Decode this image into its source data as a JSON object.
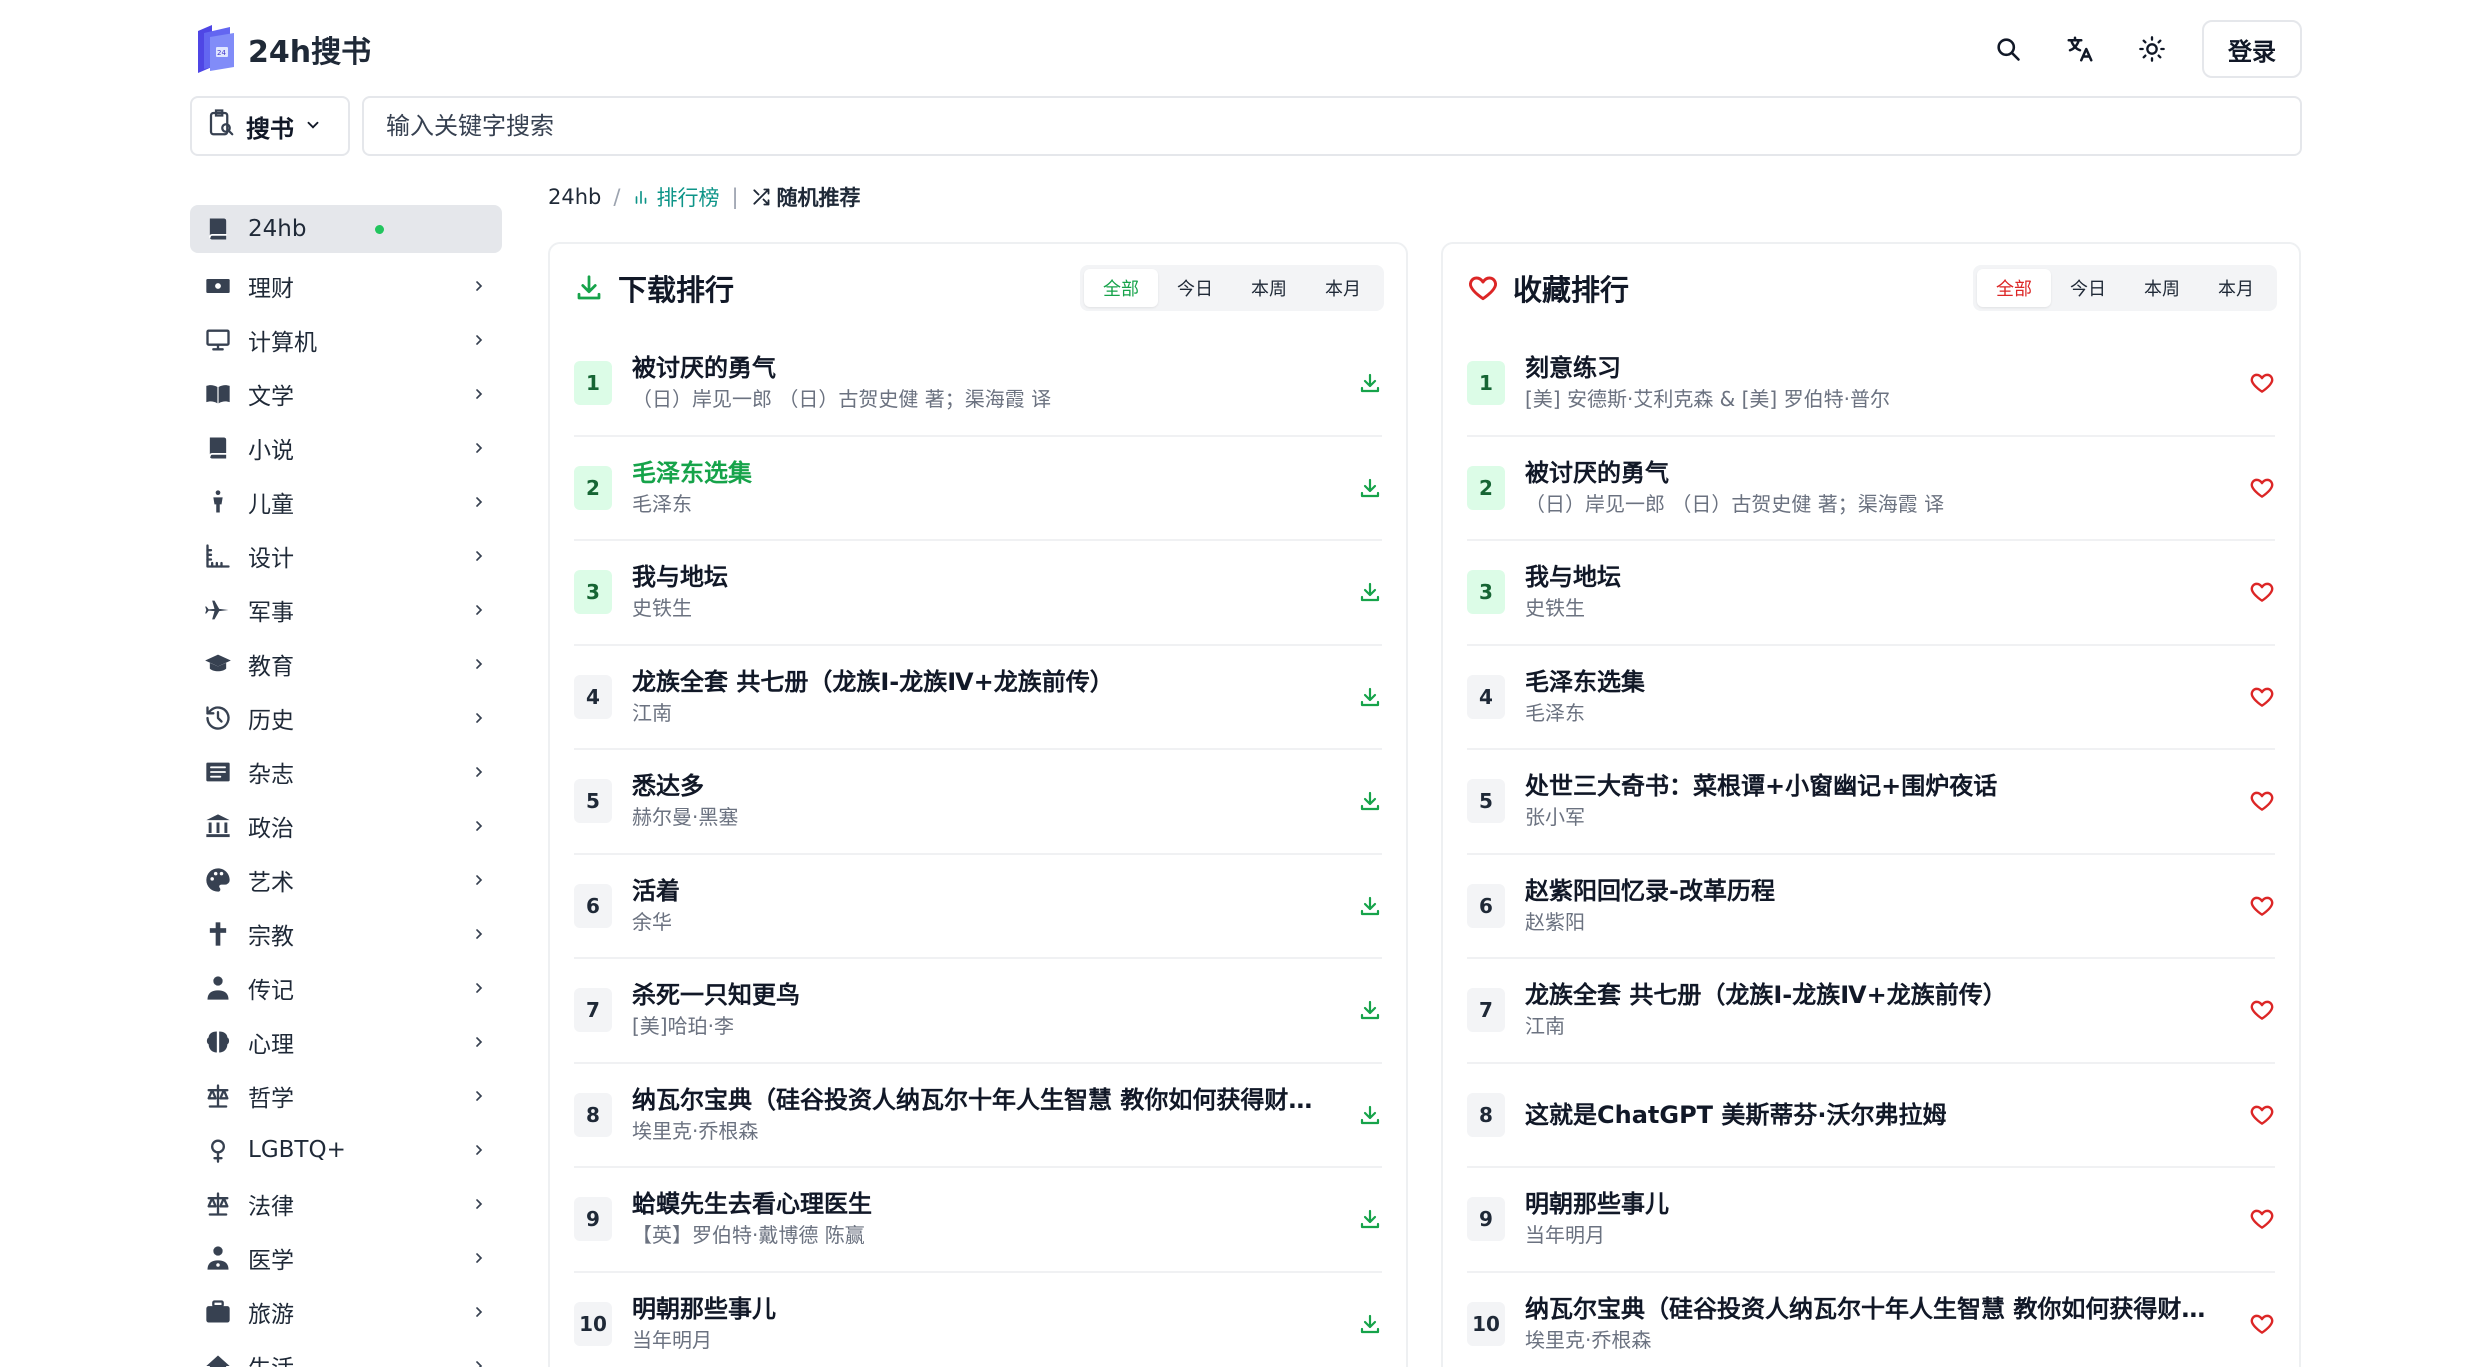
{
  "app": {
    "name": "24h搜书"
  },
  "header": {
    "login_label": "登录"
  },
  "search": {
    "select_label": "搜书",
    "placeholder": "输入关键字搜索"
  },
  "breadcrumb": {
    "home": "24hb",
    "sep": "/",
    "rank": "排行榜",
    "divider": "|",
    "random": "随机推荐"
  },
  "sidebar": {
    "items": [
      {
        "label": "24hb",
        "icon": "book-icon"
      },
      {
        "label": "理财",
        "icon": "money-icon"
      },
      {
        "label": "计算机",
        "icon": "monitor-icon"
      },
      {
        "label": "文学",
        "icon": "open-book-icon"
      },
      {
        "label": "小说",
        "icon": "book-icon"
      },
      {
        "label": "儿童",
        "icon": "child-icon"
      },
      {
        "label": "设计",
        "icon": "ruler-icon"
      },
      {
        "label": "军事",
        "icon": "plane-icon"
      },
      {
        "label": "教育",
        "icon": "graduation-cap-icon"
      },
      {
        "label": "历史",
        "icon": "history-icon"
      },
      {
        "label": "杂志",
        "icon": "newspaper-icon"
      },
      {
        "label": "政治",
        "icon": "landmark-icon"
      },
      {
        "label": "艺术",
        "icon": "palette-icon"
      },
      {
        "label": "宗教",
        "icon": "cross-icon"
      },
      {
        "label": "传记",
        "icon": "person-icon"
      },
      {
        "label": "心理",
        "icon": "brain-icon"
      },
      {
        "label": "哲学",
        "icon": "scale-icon"
      },
      {
        "label": "LGBTQ+",
        "icon": "gender-icon"
      },
      {
        "label": "法律",
        "icon": "scale-icon"
      },
      {
        "label": "医学",
        "icon": "doctor-icon"
      },
      {
        "label": "旅游",
        "icon": "suitcase-icon"
      },
      {
        "label": "生活",
        "icon": "home-icon"
      }
    ]
  },
  "download_panel": {
    "title": "下载排行",
    "tabs": [
      "全部",
      "今日",
      "本周",
      "本月"
    ],
    "active_tab": "全部",
    "rows": [
      {
        "rank": "1",
        "title": "被讨厌的勇气",
        "author": "（日）岸见一郎 （日）古贺史健 著；渠海霞 译"
      },
      {
        "rank": "2",
        "title": "毛泽东选集",
        "author": "毛泽东"
      },
      {
        "rank": "3",
        "title": "我与地坛",
        "author": "史铁生"
      },
      {
        "rank": "4",
        "title": "龙族全套 共七册（龙族Ⅰ-龙族Ⅳ+龙族前传）",
        "author": "江南"
      },
      {
        "rank": "5",
        "title": "悉达多",
        "author": "赫尔曼·黑塞"
      },
      {
        "rank": "6",
        "title": "活着",
        "author": "余华"
      },
      {
        "rank": "7",
        "title": "杀死一只知更鸟",
        "author": "[美]哈珀·李"
      },
      {
        "rank": "8",
        "title": "纳瓦尔宝典（硅谷投资人纳瓦尔十年人生智慧 教你如何获得财富与幸福）",
        "author": "埃里克·乔根森"
      },
      {
        "rank": "9",
        "title": "蛤蟆先生去看心理医生",
        "author": "【英】罗伯特·戴博德 陈赢"
      },
      {
        "rank": "10",
        "title": "明朝那些事儿",
        "author": "当年明月"
      }
    ]
  },
  "favorite_panel": {
    "title": "收藏排行",
    "tabs": [
      "全部",
      "今日",
      "本周",
      "本月"
    ],
    "active_tab": "全部",
    "rows": [
      {
        "rank": "1",
        "title": "刻意练习",
        "author": "[美] 安德斯·艾利克森 & [美] 罗伯特·普尔"
      },
      {
        "rank": "2",
        "title": "被讨厌的勇气",
        "author": "（日）岸见一郎 （日）古贺史健 著；渠海霞 译"
      },
      {
        "rank": "3",
        "title": "我与地坛",
        "author": "史铁生"
      },
      {
        "rank": "4",
        "title": "毛泽东选集",
        "author": "毛泽东"
      },
      {
        "rank": "5",
        "title": "处世三大奇书：菜根谭+小窗幽记+围炉夜话",
        "author": "张小军"
      },
      {
        "rank": "6",
        "title": "赵紫阳回忆录-改革历程",
        "author": "赵紫阳"
      },
      {
        "rank": "7",
        "title": "龙族全套 共七册（龙族Ⅰ-龙族Ⅳ+龙族前传）",
        "author": "江南"
      },
      {
        "rank": "8",
        "title": "这就是ChatGPT 美斯蒂芬·沃尔弗拉姆",
        "author": ""
      },
      {
        "rank": "9",
        "title": "明朝那些事儿",
        "author": "当年明月"
      },
      {
        "rank": "10",
        "title": "纳瓦尔宝典（硅谷投资人纳瓦尔十年人生智慧 教你如何获得财富与幸福）",
        "author": "埃里克·乔根森"
      }
    ]
  },
  "colors": {
    "accent_green": "#16a34a",
    "accent_teal": "#0d9488",
    "accent_red": "#dc2626",
    "logo_blue": "#4f46e5"
  }
}
